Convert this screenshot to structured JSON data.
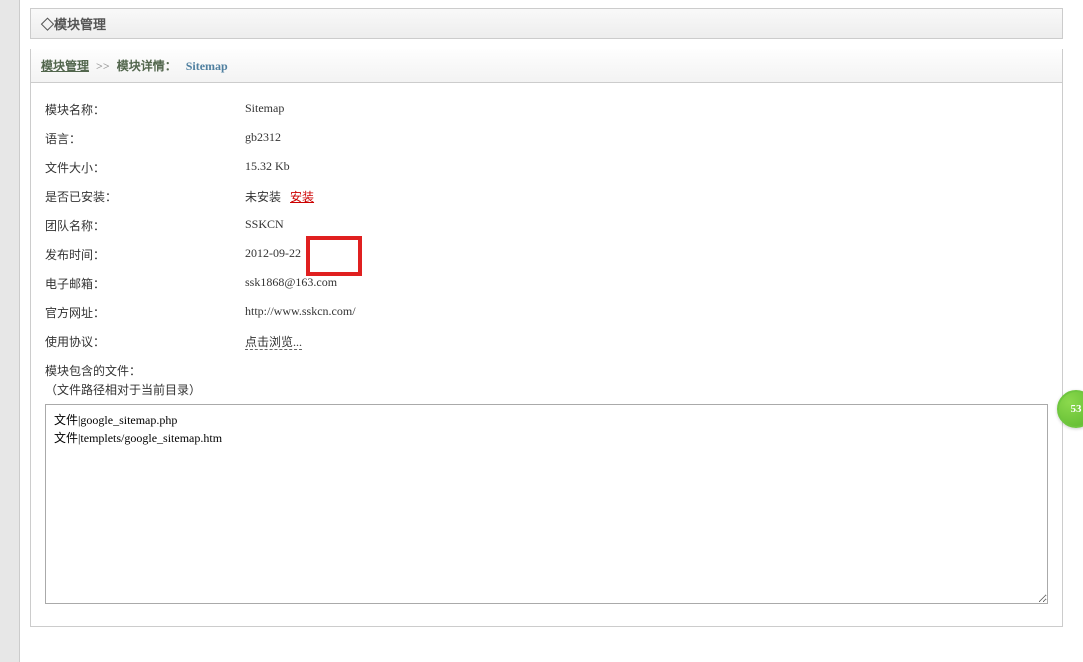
{
  "titleBar": {
    "diamond": "◇",
    "title": "模块管理"
  },
  "breadcrumb": {
    "link": "模块管理",
    "separator": ">>",
    "currentLabel": "模块详情：",
    "currentValue": "Sitemap"
  },
  "fields": {
    "moduleName": {
      "label": "模块名称：",
      "value": "Sitemap"
    },
    "language": {
      "label": "语言：",
      "value": "gb2312"
    },
    "fileSize": {
      "label": "文件大小：",
      "value": "15.32 Kb"
    },
    "installed": {
      "label": "是否已安装：",
      "status": "未安装",
      "link": "安装"
    },
    "teamName": {
      "label": "团队名称：",
      "value": "SSKCN"
    },
    "publishTime": {
      "label": "发布时间：",
      "value": "2012-09-22"
    },
    "email": {
      "label": "电子邮箱：",
      "value": "ssk1868@163.com"
    },
    "website": {
      "label": "官方网址：",
      "value": "http://www.sskcn.com/"
    },
    "license": {
      "label": "使用协议：",
      "link": "点击浏览..."
    },
    "filesLabel": "模块包含的文件：",
    "filesSublabel": "（文件路径相对于当前目录）",
    "filesContent": "文件|google_sitemap.php\n文件|templets/google_sitemap.htm"
  },
  "floatingBadge": "53"
}
